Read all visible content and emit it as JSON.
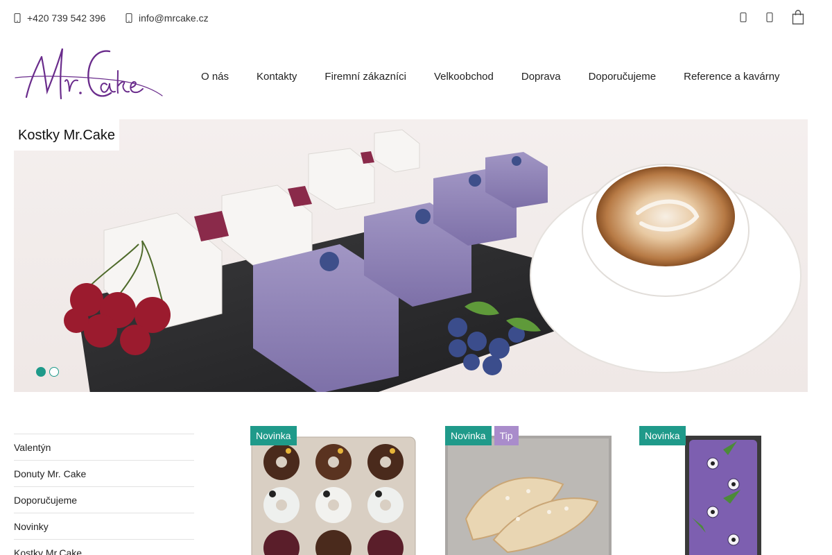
{
  "topbar": {
    "phone": "+420 739 542 396",
    "email": "info@mrcake.cz",
    "phone_icon": "phone-icon",
    "email_icon": "envelope-icon",
    "right_icons": [
      "user-icon",
      "search-icon",
      "cart-icon"
    ]
  },
  "logo": {
    "text": "Mr. Cake",
    "color": "#6a2c8c"
  },
  "nav": {
    "items": [
      "O nás",
      "Kontakty",
      "Firemní zákazníci",
      "Velkoobchod",
      "Doprava",
      "Doporučujeme",
      "Reference a kavárny"
    ]
  },
  "hero": {
    "label": "Kostky Mr.Cake",
    "slides": 2,
    "active_slide": 1
  },
  "categories": [
    "Valentýn",
    "Donuty Mr. Cake",
    "Doporučujeme",
    "Novinky",
    "Kostky Mr.Cake"
  ],
  "products": [
    {
      "badges": [
        "Novinka"
      ]
    },
    {
      "badges": [
        "Novinka",
        "Tip"
      ]
    },
    {
      "badges": [
        "Novinka"
      ]
    }
  ],
  "colors": {
    "accent": "#1f9a8a",
    "tip": "#a98ccb",
    "brand": "#6a2c8c"
  }
}
